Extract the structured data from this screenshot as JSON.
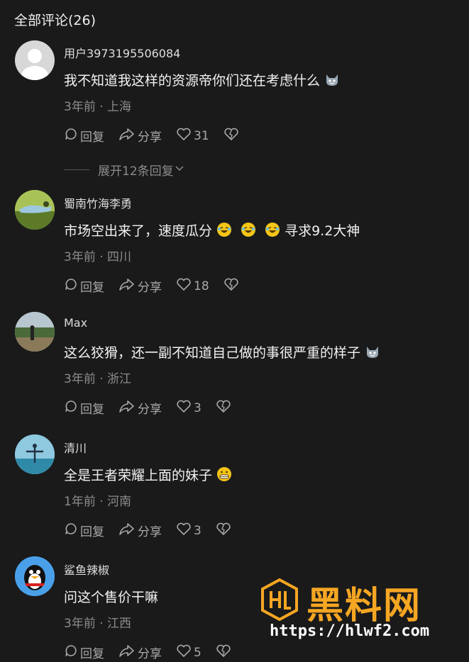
{
  "header": {
    "title": "全部评论(26)"
  },
  "comments": [
    {
      "user": "用户3973195506084",
      "text": "我不知道我这样的资源帝你们还在考虑什么",
      "emoji": "cat-face-icon",
      "time": "3年前",
      "location": "上海",
      "reply": "回复",
      "share": "分享",
      "likes": "31"
    },
    {
      "user": "蜀南竹海李勇",
      "text": "市场空出来了，速度瓜分",
      "text2": "寻求9.2大神",
      "emoji": "rolling-laugh-icon",
      "time": "3年前",
      "location": "四川",
      "reply": "回复",
      "share": "分享",
      "likes": "18"
    },
    {
      "user": "Max",
      "text": "这么狡猾，还一副不知道自己做的事很严重的样子",
      "emoji": "cat-face-icon",
      "time": "3年前",
      "location": "浙江",
      "reply": "回复",
      "share": "分享",
      "likes": "3"
    },
    {
      "user": "清川",
      "text": "全是王者荣耀上面的妹子",
      "emoji": "grimace-icon",
      "time": "1年前",
      "location": "河南",
      "reply": "回复",
      "share": "分享",
      "likes": "3"
    },
    {
      "user": "鲨鱼辣椒",
      "text": "问这个售价干嘛",
      "time": "3年前",
      "location": "江西",
      "reply": "回复",
      "share": "分享",
      "likes": "5"
    }
  ],
  "expand_replies": "展开12条回复",
  "separator": "·",
  "watermark": {
    "name": "黑料网",
    "url": "https://hlwf2.com",
    "color": "#f5a623"
  }
}
